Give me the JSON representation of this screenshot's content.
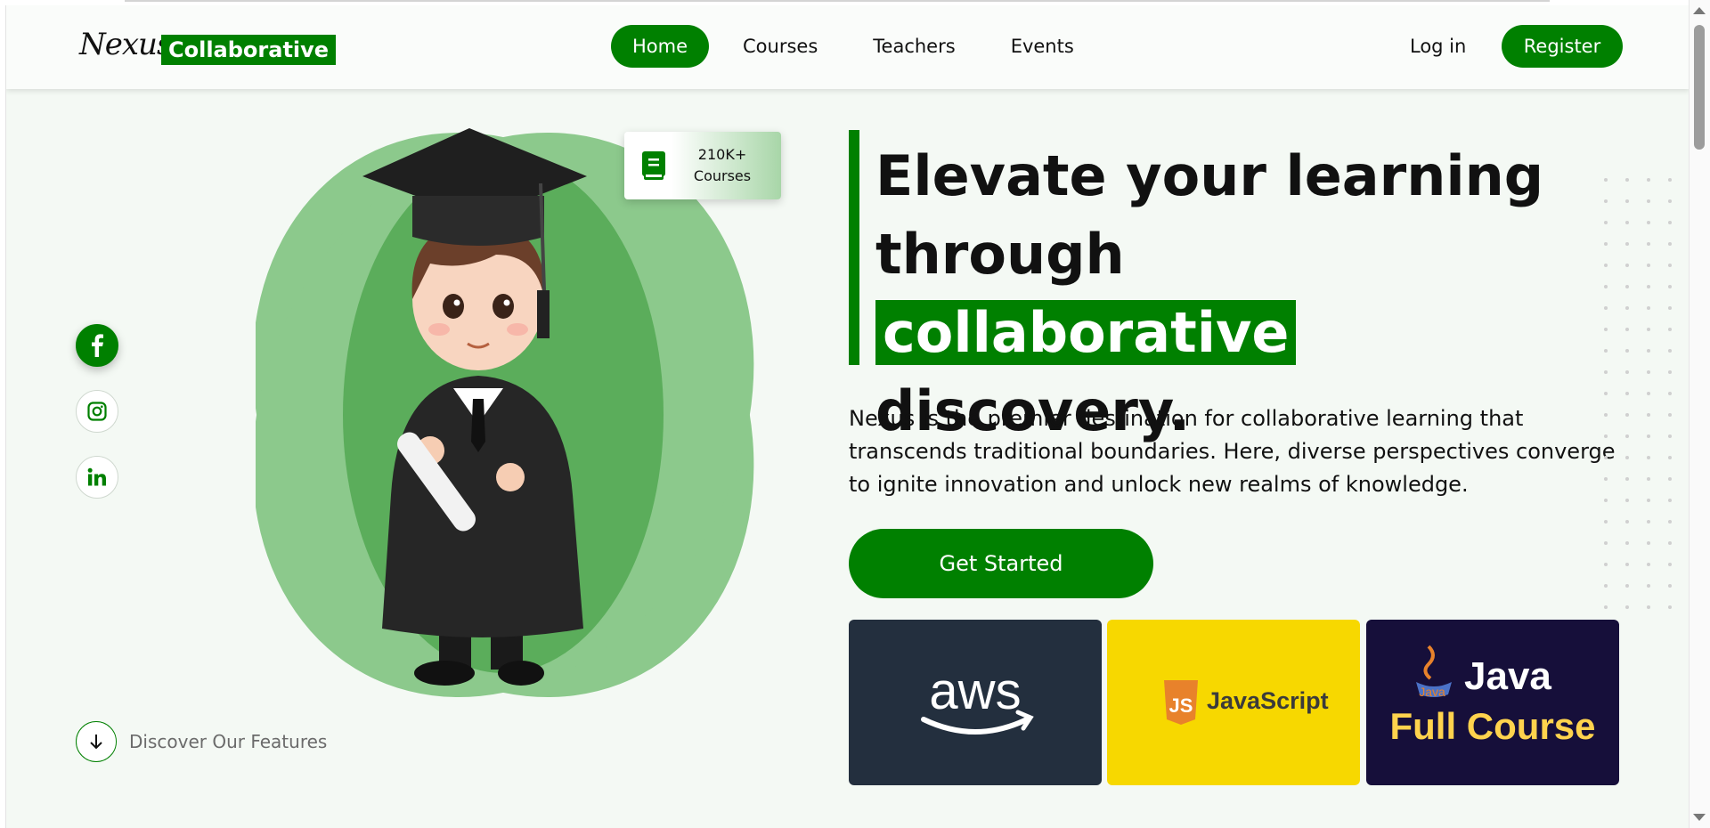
{
  "brand": {
    "script": "Nexus",
    "box": "Collaborative"
  },
  "nav": {
    "links": [
      {
        "label": "Home",
        "active": true
      },
      {
        "label": "Courses"
      },
      {
        "label": "Teachers"
      },
      {
        "label": "Events"
      }
    ],
    "login": "Log in",
    "register": "Register"
  },
  "badge": {
    "count": "210K+",
    "label": "Courses"
  },
  "hero": {
    "headline_part1": "Elevate your learning",
    "headline_part2": "through",
    "headline_highlight": "collaborative",
    "headline_part3": "discovery.",
    "paragraph": "Nexus is the premier destination for collaborative learning that transcends traditional boundaries. Here, diverse perspectives converge to ignite innovation and unlock new realms of knowledge.",
    "cta": "Get Started"
  },
  "discover": "Discover Our Features",
  "cards": {
    "aws": "aws",
    "js": "JavaScript",
    "js_badge": "JS",
    "java_small": "Java",
    "java_title": "Java",
    "java_subtitle": "Full Course"
  },
  "colors": {
    "brand_green": "#008000",
    "light_green": "#8cc98c",
    "mid_green": "#52a852"
  }
}
